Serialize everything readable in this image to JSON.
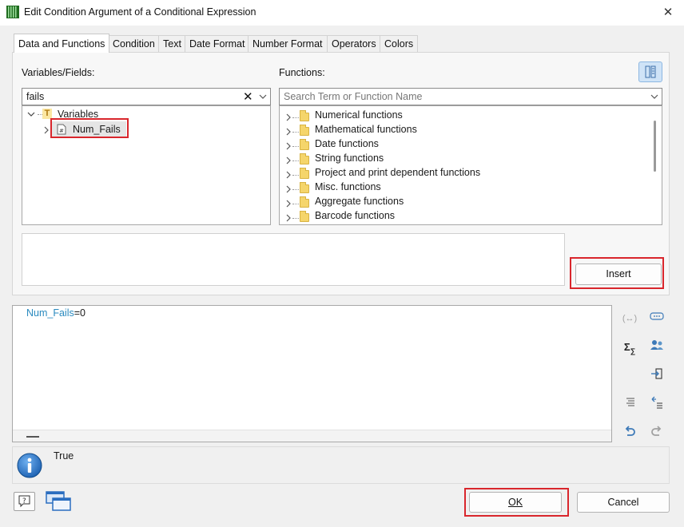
{
  "window": {
    "title": "Edit Condition Argument of a Conditional Expression",
    "close_glyph": "✕",
    "icon": "report-app-icon"
  },
  "tabs": [
    {
      "label": "Data and Functions",
      "active": true
    },
    {
      "label": "Condition"
    },
    {
      "label": "Text"
    },
    {
      "label": "Date Format"
    },
    {
      "label": "Number Format"
    },
    {
      "label": "Operators"
    },
    {
      "label": "Colors"
    }
  ],
  "variables": {
    "label": "Variables/Fields:",
    "filter_value": "fails",
    "clear_glyph": "✕",
    "tree": [
      {
        "label": "Variables",
        "icon": "variables-folder-icon",
        "expanded": true
      },
      {
        "label": "Num_Fails",
        "icon": "numeric-field-icon",
        "selected": true
      }
    ]
  },
  "functions": {
    "label": "Functions:",
    "search_placeholder": "Search Term or Function Name",
    "items": [
      "Numerical functions",
      "Mathematical functions",
      "Date functions",
      "String functions",
      "Project and print dependent functions",
      "Misc. functions",
      "Aggregate functions",
      "Barcode functions"
    ]
  },
  "insert_label": "Insert",
  "expression": {
    "field": "Num_Fails",
    "rest": "=0"
  },
  "result": {
    "value": "True",
    "icon": "info-icon"
  },
  "footer": {
    "ok_label": "OK",
    "cancel_label": "Cancel"
  },
  "colors": {
    "accent_red": "#d9262c",
    "field_blue": "#2a8abf",
    "selection": "#e5e5e5"
  }
}
